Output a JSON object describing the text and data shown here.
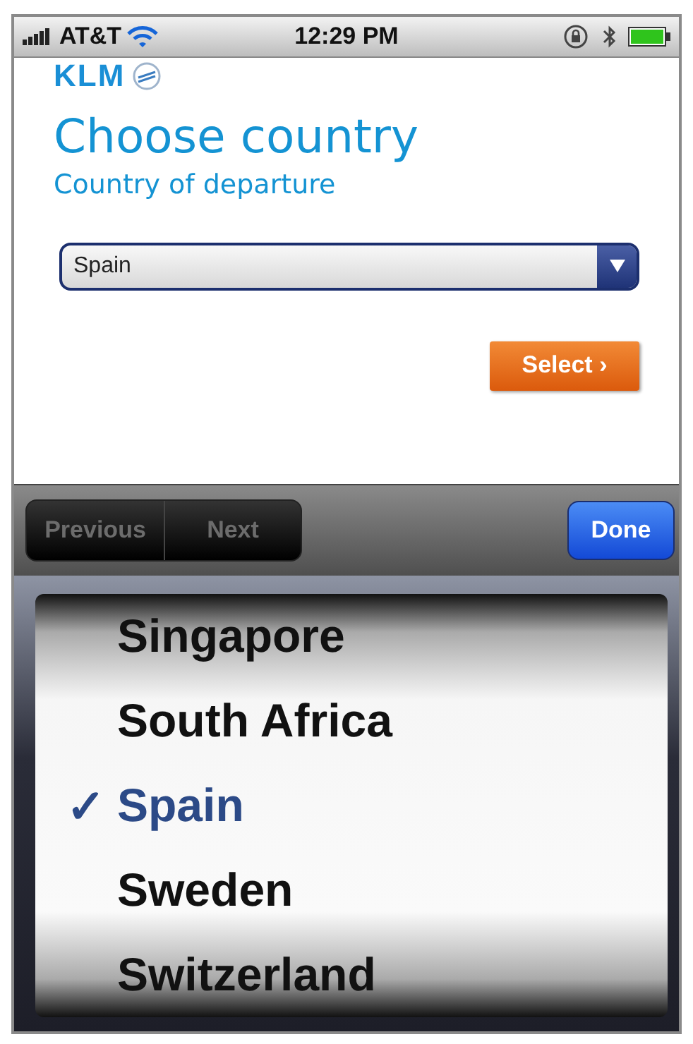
{
  "status_bar": {
    "carrier": "AT&T",
    "time": "12:29 PM"
  },
  "logo": {
    "text": "KLM"
  },
  "heading": {
    "title": "Choose country",
    "subtitle": "Country of departure"
  },
  "country_select": {
    "value": "Spain"
  },
  "select_button": {
    "label": "Select",
    "chevron": "›"
  },
  "toolbar": {
    "buttons": [
      {
        "label": "Previous",
        "disabled": true
      },
      {
        "label": "Next",
        "disabled": true
      }
    ],
    "done": "Done"
  },
  "picker": {
    "check_mark": "✓",
    "items": [
      {
        "label": "Singapore",
        "selected": false
      },
      {
        "label": "South Africa",
        "selected": false
      },
      {
        "label": "Spain",
        "selected": true
      },
      {
        "label": "Sweden",
        "selected": false
      },
      {
        "label": "Switzerland",
        "selected": false
      }
    ]
  }
}
